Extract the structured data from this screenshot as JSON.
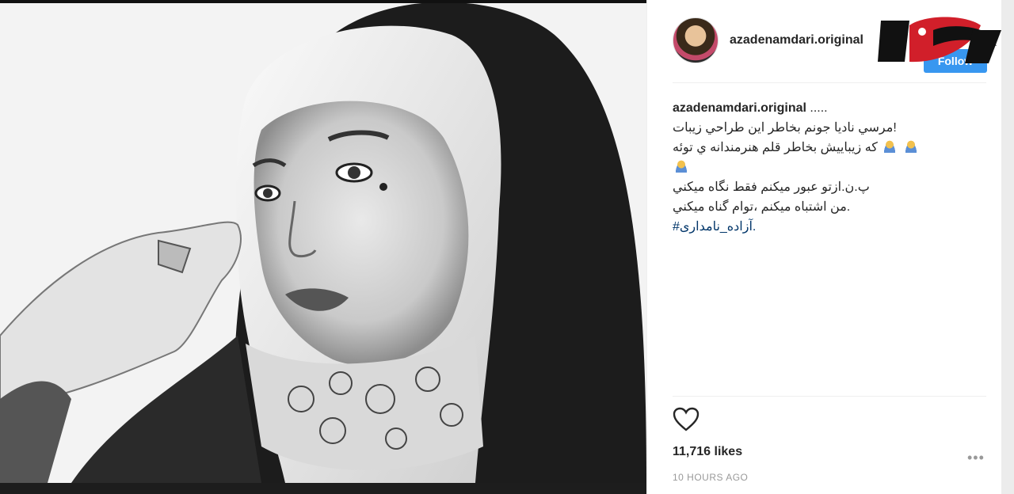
{
  "post": {
    "username": "azadenamdari.original",
    "follow_label": "Follow",
    "caption_user": "azadenamdari.original",
    "caption_suffix": ".....",
    "caption_lines": {
      "l1": "مرسي ناديا جونم بخاطر اين طراحي زيبات!",
      "l2": "كه زيباييش بخاطر قلم هنرمندانه ي توئه",
      "l4": "پ.ن.ازتو عبور ميكنم فقط نگاه ميكني",
      "l5": "من اشتباه ميكنم ،توام گناه ميكني.",
      "l6": "#آزاده_نامداری."
    },
    "likes": "11,716 likes",
    "time": "10 HOURS AGO",
    "more": "•••"
  },
  "icons": {
    "like": "heart-icon",
    "avatar": "avatar",
    "logo": "rokna-logo",
    "emoji": "person-emoji"
  }
}
